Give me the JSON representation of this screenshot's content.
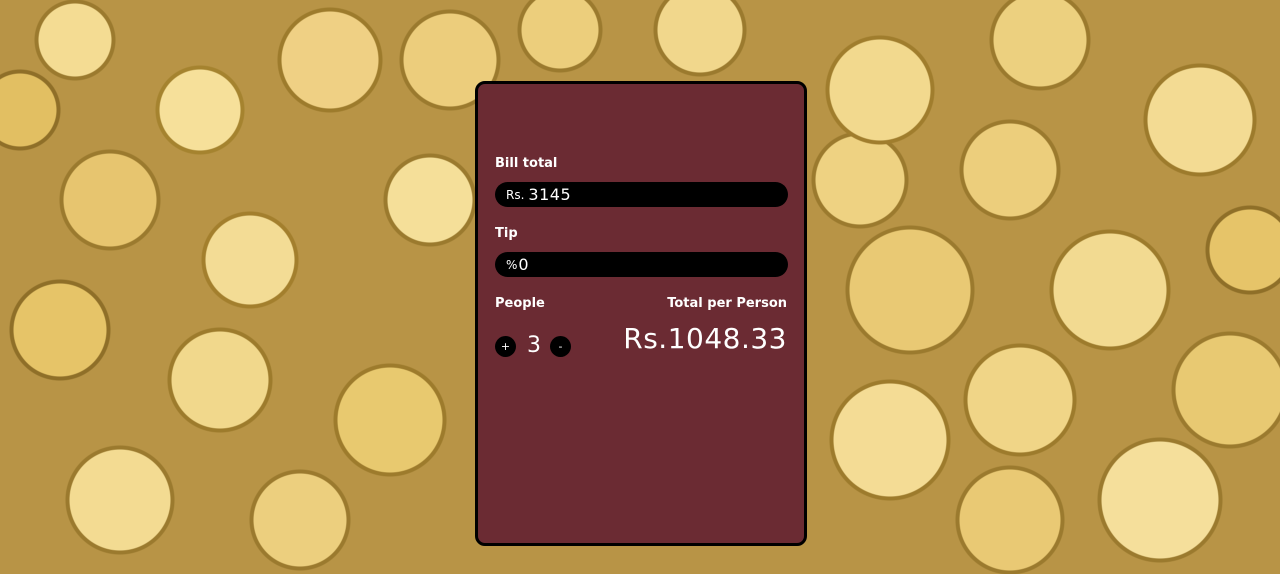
{
  "calculator": {
    "bill_label": "Bill total",
    "bill_prefix": "Rs.",
    "bill_value": "3145",
    "tip_label": "Tip",
    "tip_prefix": "%",
    "tip_value": "0",
    "people_label": "People",
    "increment_label": "+",
    "people_count": "3",
    "decrement_label": "-",
    "total_label": "Total per Person",
    "total_value": "Rs.1048.33"
  },
  "colors": {
    "card_background": "#6b2b33",
    "field_background": "#000000",
    "text": "#ffffff"
  }
}
